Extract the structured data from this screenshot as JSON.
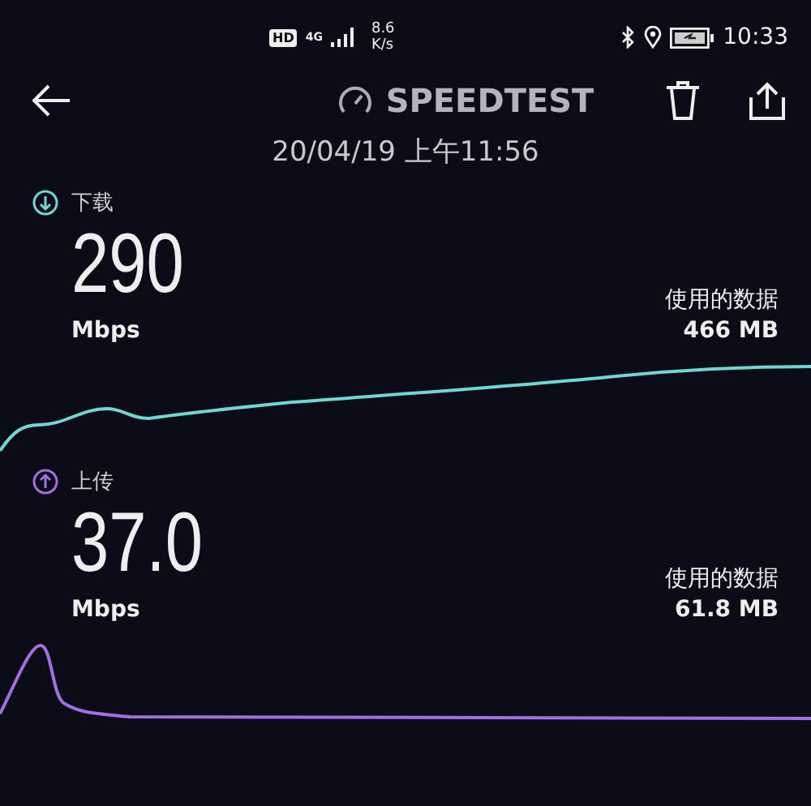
{
  "status_bar": {
    "hd": "HD",
    "network": "4G",
    "speed": "8.6",
    "speed_unit": "K/s",
    "time": "10:33"
  },
  "header": {
    "title": "SPEEDTEST",
    "date": "20/04/19 上午11:56"
  },
  "results": [
    {
      "kind": "download",
      "label": "下载",
      "value": "290",
      "unit": "Mbps",
      "data_label": "使用的数据",
      "data_value": "466 MB",
      "color": "#6fd6d0"
    },
    {
      "kind": "upload",
      "label": "上传",
      "value": "37.0",
      "unit": "Mbps",
      "data_label": "使用的数据",
      "data_value": "61.8 MB",
      "color": "#a070e0"
    }
  ]
}
